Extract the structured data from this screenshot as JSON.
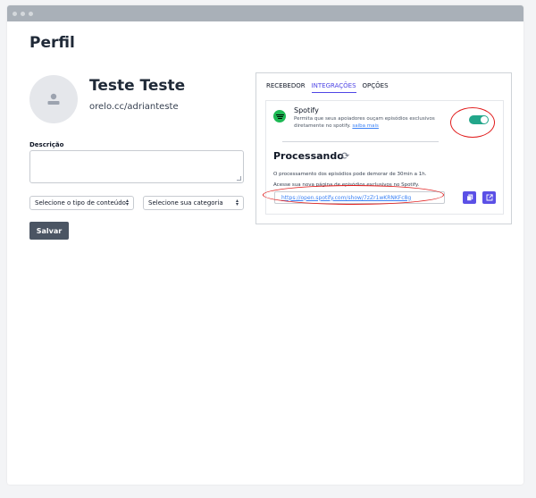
{
  "page": {
    "title": "Perfil"
  },
  "profile": {
    "name": "Teste Teste",
    "url": "orelo.cc/adrianteste",
    "avatar_icon": "user-icon"
  },
  "form": {
    "description_label": "Descrição",
    "description_value": "",
    "content_type_select": "Selecione o tipo de conteúdo",
    "category_select": "Selecione sua categoria",
    "save_label": "Salvar"
  },
  "tabs": [
    {
      "label": "RECEBEDOR",
      "active": false
    },
    {
      "label": "INTEGRAÇÕES",
      "active": true
    },
    {
      "label": "OPÇÕES",
      "active": false
    }
  ],
  "spotify": {
    "title": "Spotify",
    "description": "Permita que seus apoiadores ouçam episódios exclusivos diretamente no spotify.",
    "link_label": "saiba mais",
    "enabled": true,
    "processing_title": "Processando",
    "processing_note": "O processamento dos episódios pode demorar de 30min a 1h.",
    "access_note": "Acesse sua nova página de episódios exclusivos no Spotify.",
    "show_url": "https://open.spotify.com/show/7zZr1wKRNKFc8g",
    "copy_icon": "copy-icon",
    "open_icon": "external-link-icon",
    "refresh_icon": "refresh-icon"
  },
  "colors": {
    "accent": "#4f46e5",
    "button_dark": "#4b5563",
    "toggle_on": "#22a68a",
    "spotify_green": "#1db954",
    "annotation_red": "#e11d1d"
  }
}
